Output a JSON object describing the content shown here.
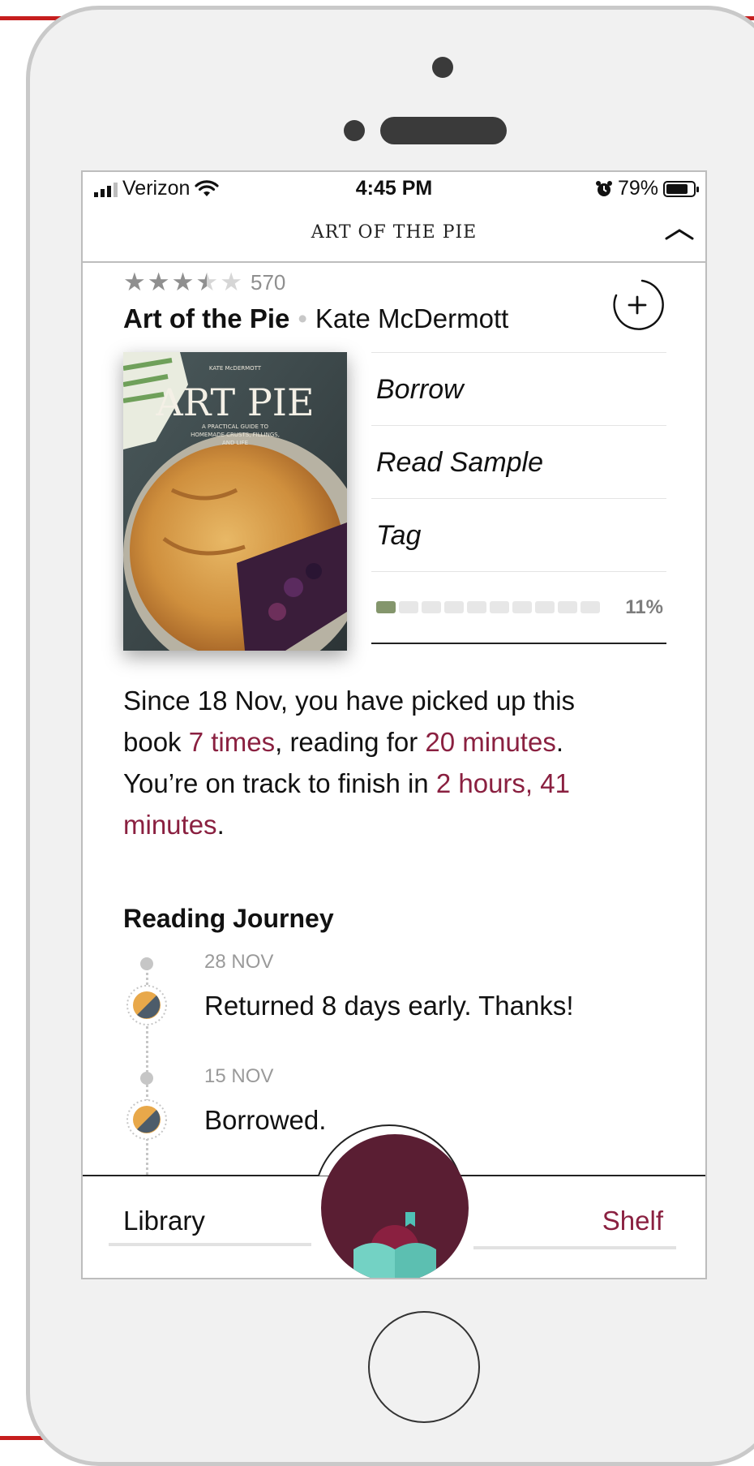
{
  "status_bar": {
    "carrier": "Verizon",
    "time": "4:45 PM",
    "battery": "79%"
  },
  "header": {
    "title": "ART OF THE PIE"
  },
  "book": {
    "rating_count": "570",
    "rating": 3.5,
    "title": "Art of the Pie",
    "author": "Kate McDermott"
  },
  "actions": [
    {
      "label": "Borrow"
    },
    {
      "label": "Read Sample"
    },
    {
      "label": "Tag"
    }
  ],
  "progress": {
    "percent_label": "11%",
    "value": 0.11
  },
  "summary": {
    "p1": "Since 18 Nov, you have picked up this book ",
    "times": "7 times",
    "p2": ", reading for ",
    "minutes": "20 minutes",
    "p3": ". You’re on track to finish in ",
    "finish": "2 hours, 41 minutes",
    "p4": "."
  },
  "journey": {
    "title": "Reading Journey",
    "events": [
      {
        "date": "28 NOV",
        "text": "Returned 8 days early. Thanks!"
      },
      {
        "date": "15 NOV",
        "text": "Borrowed."
      }
    ]
  },
  "tabs": {
    "library": "Library",
    "shelf": "Shelf"
  },
  "colors": {
    "accent": "#8a2040",
    "center_button": "#5a1e33",
    "progress_fill": "#84966c"
  }
}
